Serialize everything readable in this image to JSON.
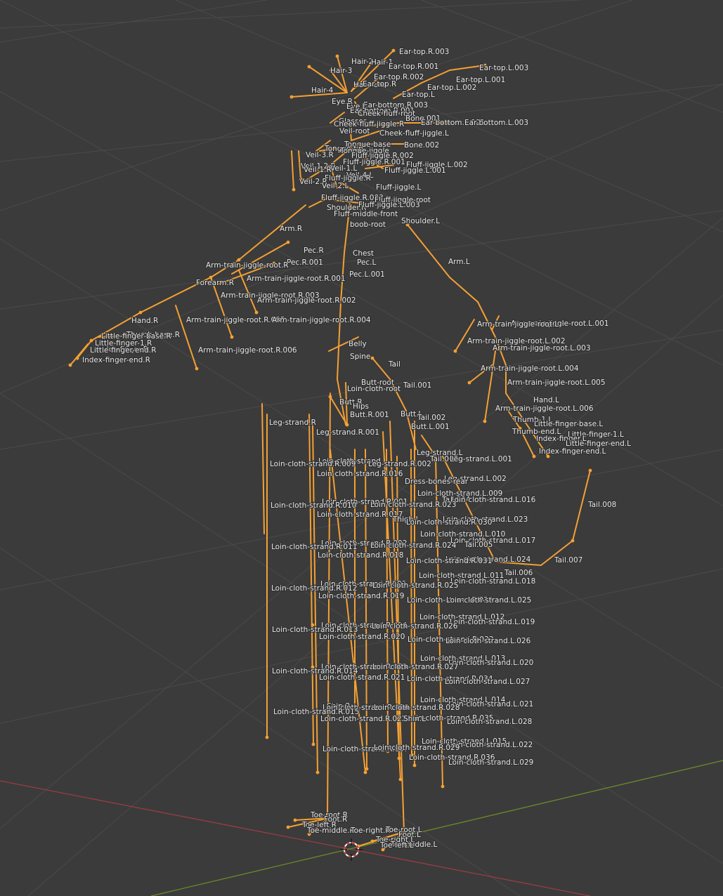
{
  "viewport": {
    "bone_color": "#f4a033",
    "grid_color": "#4a4a4a",
    "x_axis_color": "#9a3c44",
    "y_axis_color": "#6b8a2a",
    "cursor_colors": [
      "#d83a3a",
      "#ffffff"
    ]
  },
  "bone_labels": [
    "Ear-top.R.003",
    "Hair-2",
    "Hair-1",
    "Ear-top.R.001",
    "Ear-top.L.003",
    "Hair-3",
    "Ear-top.R.002",
    "Ear-top.L.001",
    "Hair-root",
    "Ear-top.R",
    "Ear-top.L.002",
    "Hair-4",
    "Ear-top.L",
    "Eye.R",
    "Ear-bottom.R.003",
    "Eye.L",
    "Ear-bottom.R.001",
    "Cheek-fluff-root",
    "Glasses",
    "Bone.001",
    "Ear-bottom.L.001",
    "Ear-bottom.L.003",
    "Cheek-fluff-jiggle.R",
    "Veil-root",
    "Cheek-fluff-jiggle.L",
    "Tongue-base",
    "Bone.002",
    "Tongue-tip",
    "Tongue-jiggle",
    "Veil-3.R",
    "Fluff-jiggle.R.002",
    "Fluff-jiggle.R.001",
    "Fluff-jiggle.L.002",
    "Veil-1.2.R",
    "Veil-1.L",
    "Fluff-jiggle.L.001",
    "Veil-1.R",
    "Veil-4.L",
    "Fluff-jiggle.R",
    "Veil-2.R",
    "Veil-2.L",
    "Fluff-jiggle.L",
    "Fluff-jiggle.R.003",
    "Fluff-jiggle-root",
    "Shoulder.R",
    "Fluff-jiggle.L.003",
    "Fluff-middle-front",
    "boob-root",
    "Shoulder.L",
    "Arm.R",
    "Pec.R",
    "Chest",
    "Pec.L",
    "Pec.R.001",
    "Arm-train-jiggle-root.R",
    "Arm.L",
    "Pec.L.001",
    "Arm-train-jiggle-root.R.001",
    "Forearm.R",
    "Arm-train-jiggle-root.R.003",
    "Arm-train-jiggle-root.R.002",
    "Hand.R",
    "Arm-train-jiggle-root.R.005",
    "Arm-train-jiggle-root.R.004",
    "Arm-train-jiggle-root.L.001",
    "Arm-train-jiggle-root.L",
    "Thumb-base.R",
    "Little-finger-base.R",
    "Little-finger-1.R",
    "Index-finger.R",
    "Little-finger-end.R",
    "Index-finger-end.R",
    "Arm-train-jiggle-root.L.002",
    "Arm-train-jiggle-root.L.003",
    "Belly",
    "Arm-train-jiggle-root.R.006",
    "Spine",
    "Tail",
    "Arm-train-jiggle-root.L.004",
    "Butt-root",
    "Loin-cloth-root",
    "Tail.001",
    "Arm-train-jiggle-root.L.005",
    "Butt.R",
    "Hips",
    "Hand.L",
    "Butt.R.001",
    "Butt.L",
    "Arm-train-jiggle-root.L.006",
    "Tail.002",
    "Thumb-1.L",
    "Leg-strand.R",
    "Butt.L.001",
    "Little-finger-base.L",
    "Leg-strand.R.001",
    "Thumb-end.L",
    "Little-finger-1.L",
    "Index-finger.L",
    "Leg-strand.L",
    "Little-finger-end.L",
    "Index-finger-end.L",
    "Tail.003",
    "Leg-strand.L.001",
    "Loin-cloth-strand",
    "Loin-cloth-strand.R.009",
    "Leg-strand.R.002",
    "Loin-cloth-strand.R.016",
    "Leg-strand.L.002",
    "Dress-bones-rear",
    "Loin-cloth-strand.L.009",
    "Tail.004",
    "Loin-cloth-strand.L.016",
    "Tail.008",
    "Loin-cloth-strand.R.001",
    "Loin-cloth-strand.R.010",
    "Loin-cloth-strand.R.023",
    "Loin-cloth-strand.R.017",
    "Loin-cloth-strand.L.023",
    "Thigh.L",
    "Loin-cloth-strand.R.030",
    "Loin-cloth-strand.L.010",
    "Loin-cloth-strand.L.017",
    "Tail.005",
    "Loin-cloth-strand.R.002",
    "Loin-cloth-strand.R.011",
    "Loin-cloth-strand.R.024",
    "Loin-cloth-strand.R.018",
    "Loin-cloth-strand.L.024",
    "Tail.007",
    "Loin-cloth-strand.R.031",
    "Tail.006",
    "Loin-cloth-strand.L.011",
    "Loin-cloth-strand.L.018",
    "Loin-cloth-strand.R.003",
    "Loin-cloth-strand.R.012",
    "Loin-cloth-strand.R.025",
    "Loin-cloth-strand.R.019",
    "Loin-cloth-strand.R.032",
    "Loin-cloth-strand.L.025",
    "Loin-cloth-strand.L.012",
    "Loin-cloth-strand.L.019",
    "Loin-cloth-strand.R.004",
    "Loin-cloth-strand.R.013",
    "Loin-cloth-strand.R.026",
    "Loin-cloth-strand.R.020",
    "Loin-cloth-strand.R.033",
    "Loin-cloth-strand.L.026",
    "Loin-cloth-strand.L.013",
    "Loin-cloth-strand.L.020",
    "Loin-cloth-strand.R.005",
    "Loin-cloth-strand.R.014",
    "Loin-cloth-strand.R.027",
    "Loin-cloth-strand.R.021",
    "Loin-cloth-strand.R.034",
    "Loin-cloth-strand.L.027",
    "Loin-cloth-strand.L.014",
    "Loin-cloth-strand.L.021",
    "Shin.R",
    "Loin-cloth-strand.R.006",
    "Loin-cloth-strand.R.015",
    "Loin-cloth-strand.R.028",
    "Loin-cloth-strand.R.022",
    "Loin-cloth-strand.R.035",
    "Loin-cloth-strand.L.028",
    "Shin.L",
    "Loin-cloth-strand.L.015",
    "Loin-cloth-strand.L.022",
    "Loin-cloth-strand.R.007",
    "Loin-cloth-strand.R.029",
    "Loin-cloth-strand.R.036",
    "Loin-cloth-strand.L.029",
    "Toe-root.R",
    "Foot.R",
    "Toe-left.R",
    "Toe-middle.R",
    "Toe-right.R",
    "Toe-root.L",
    "Foot.L",
    "Toe-right.L",
    "Toe-middle.L",
    "Toe-left.L"
  ]
}
